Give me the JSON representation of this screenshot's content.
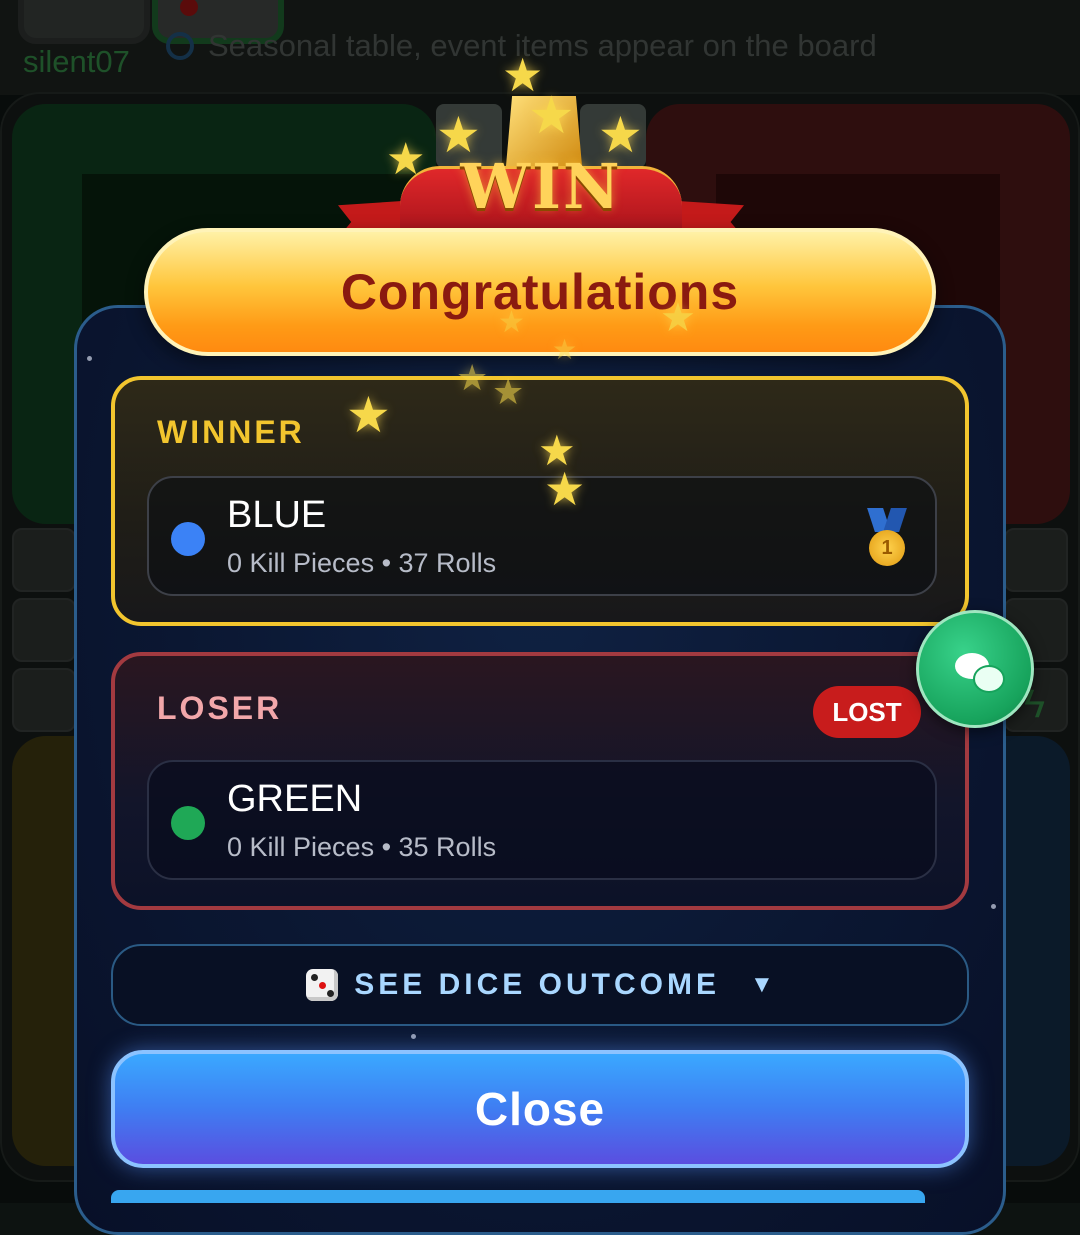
{
  "header": {
    "username": "silent07",
    "banner_text": "Seasonal table, event items appear on the board"
  },
  "emblem": {
    "text": "WIN"
  },
  "modal": {
    "title": "Congratulations",
    "winner": {
      "section_label": "WINNER",
      "name": "BLUE",
      "stats": "0 Kill Pieces • 37 Rolls",
      "color": "#3b82f6",
      "icon": "gold-medal-icon",
      "medal_number": "1"
    },
    "loser": {
      "section_label": "LOSER",
      "badge": "LOST",
      "name": "GREEN",
      "stats": "0 Kill Pieces • 35 Rolls",
      "color": "#1fa856"
    },
    "dice_button": {
      "label": "SEE DICE OUTCOME",
      "caret": "▼",
      "icon": "dice-icon"
    },
    "close_button": {
      "label": "Close"
    }
  },
  "chat_button": {
    "icon": "chat-bubbles-icon"
  },
  "colors": {
    "accent_gold": "#f2c52e",
    "loser_red": "#a33a40",
    "close_blue": "#3f7df2",
    "chat_green": "#17a35c"
  }
}
